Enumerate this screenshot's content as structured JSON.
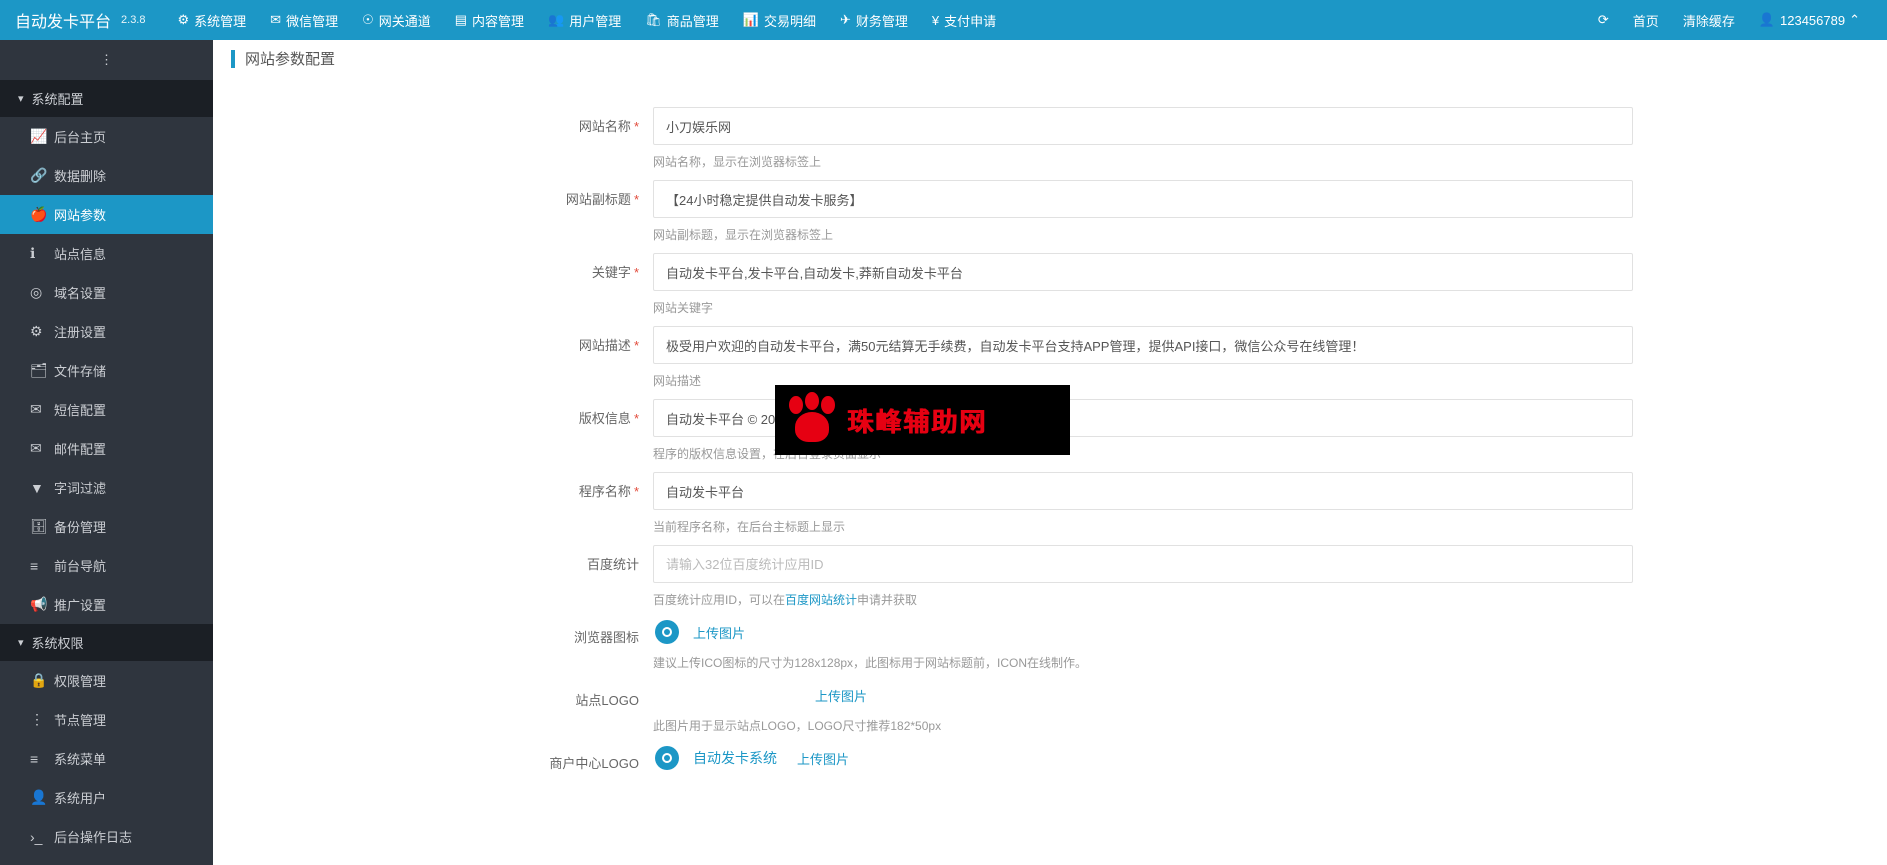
{
  "app": {
    "name": "自动发卡平台",
    "version": "2.3.8"
  },
  "navbar": {
    "items": [
      {
        "label": "系统管理",
        "icon": "⚙"
      },
      {
        "label": "微信管理",
        "icon": "✉"
      },
      {
        "label": "网关通道",
        "icon": "☉"
      },
      {
        "label": "内容管理",
        "icon": "▤"
      },
      {
        "label": "用户管理",
        "icon": "👥"
      },
      {
        "label": "商品管理",
        "icon": "🛍"
      },
      {
        "label": "交易明细",
        "icon": "📊"
      },
      {
        "label": "财务管理",
        "icon": "✈"
      },
      {
        "label": "支付申请",
        "icon": "¥"
      }
    ],
    "right": {
      "refresh_icon": "⟳",
      "home_label": "首页",
      "clear_cache_label": "清除缓存",
      "user_label": "123456789",
      "user_icon": "👤",
      "caret": "⌃"
    }
  },
  "sidebar": {
    "toggle_icon": "⋮",
    "groups": [
      {
        "label": "系统配置",
        "caret": "▾",
        "items": [
          {
            "label": "后台主页",
            "icon": "📈"
          },
          {
            "label": "数据删除",
            "icon": "🔗"
          },
          {
            "label": "网站参数",
            "icon": "🍎",
            "active": true
          },
          {
            "label": "站点信息",
            "icon": "ℹ"
          },
          {
            "label": "域名设置",
            "icon": "◎"
          },
          {
            "label": "注册设置",
            "icon": "⚙"
          },
          {
            "label": "文件存储",
            "icon": "🗂"
          },
          {
            "label": "短信配置",
            "icon": "✉"
          },
          {
            "label": "邮件配置",
            "icon": "✉"
          },
          {
            "label": "字词过滤",
            "icon": "▼"
          },
          {
            "label": "备份管理",
            "icon": "🗄"
          },
          {
            "label": "前台导航",
            "icon": "≡"
          },
          {
            "label": "推广设置",
            "icon": "📢"
          }
        ]
      },
      {
        "label": "系统权限",
        "caret": "▾",
        "items": [
          {
            "label": "权限管理",
            "icon": "🔒"
          },
          {
            "label": "节点管理",
            "icon": "⋮"
          },
          {
            "label": "系统菜单",
            "icon": "≡"
          },
          {
            "label": "系统用户",
            "icon": "👤"
          },
          {
            "label": "后台操作日志",
            "icon": "›_"
          }
        ]
      }
    ]
  },
  "page": {
    "title": "网站参数配置"
  },
  "form": {
    "site_name": {
      "label": "网站名称",
      "value": "小刀娱乐网",
      "help": "网站名称，显示在浏览器标签上"
    },
    "subtitle": {
      "label": "网站副标题",
      "value": "【24小时稳定提供自动发卡服务】",
      "help": "网站副标题，显示在浏览器标签上"
    },
    "keywords": {
      "label": "关键字",
      "value": "自动发卡平台,发卡平台,自动发卡,莽新自动发卡平台",
      "help": "网站关键字"
    },
    "description": {
      "label": "网站描述",
      "value": "极受用户欢迎的自动发卡平台，满50元结算无手续费，自动发卡平台支持APP管理，提供API接口，微信公众号在线管理！",
      "help": "网站描述"
    },
    "copyright": {
      "label": "版权信息",
      "value": "自动发卡平台 © 2014~2018 版权",
      "help": "程序的版权信息设置，在后台登录页面显示"
    },
    "program": {
      "label": "程序名称",
      "value": "自动发卡平台",
      "help": "当前程序名称，在后台主标题上显示"
    },
    "baidu": {
      "label": "百度统计",
      "placeholder": "请输入32位百度统计应用ID",
      "help_prefix": "百度统计应用ID，可以在",
      "help_link": "百度网站统计",
      "help_suffix": "申请并获取"
    },
    "favicon": {
      "label": "浏览器图标",
      "upload": "上传图片",
      "help": "建议上传ICO图标的尺寸为128x128px，此图标用于网站标题前，ICON在线制作。"
    },
    "logo": {
      "label": "站点LOGO",
      "upload": "上传图片",
      "help": "此图片用于显示站点LOGO，LOGO尺寸推荐182*50px"
    },
    "seller_logo": {
      "label": "商户中心LOGO",
      "preview_text": "自动发卡系统",
      "upload": "上传图片"
    }
  },
  "watermark": {
    "text": "珠峰辅助网"
  }
}
